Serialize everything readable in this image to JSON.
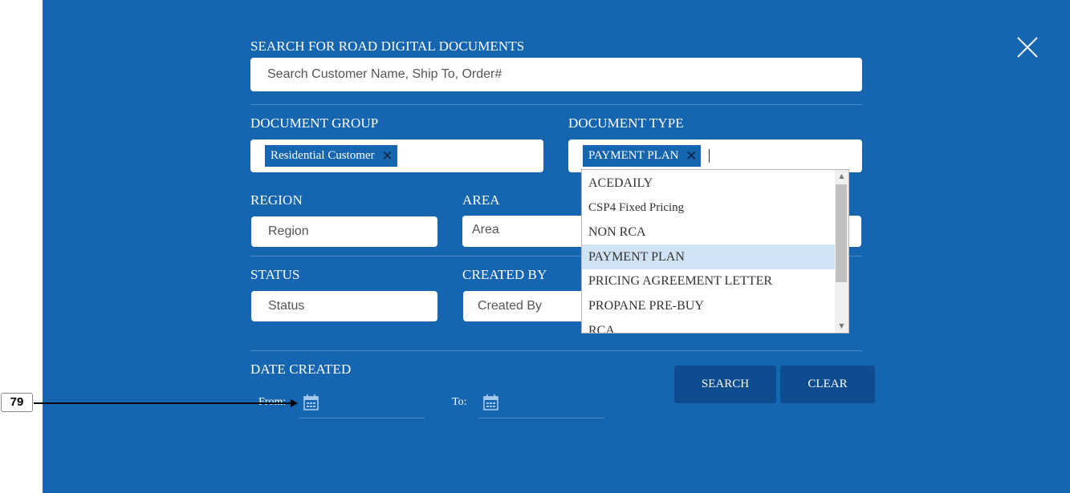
{
  "search": {
    "label": "SEARCH FOR ROAD DIGITAL DOCUMENTS",
    "placeholder": "Search Customer Name, Ship To, Order#"
  },
  "document_group": {
    "label": "DOCUMENT GROUP",
    "chip": "Residential Customer",
    "chip_remove": "✕"
  },
  "document_type": {
    "label": "DOCUMENT TYPE",
    "chip": "PAYMENT PLAN",
    "chip_remove": "✕",
    "options": [
      "ACEDAILY",
      "CSP4 Fixed Pricing",
      "NON RCA",
      "PAYMENT PLAN",
      "PRICING AGREEMENT LETTER",
      "PROPANE PRE-BUY",
      "RCA"
    ],
    "selected": "PAYMENT PLAN"
  },
  "region": {
    "label": "REGION",
    "placeholder": "Region"
  },
  "area": {
    "label": "AREA",
    "placeholder": "Area"
  },
  "status": {
    "label": "STATUS",
    "placeholder": "Status"
  },
  "created_by": {
    "label": "CREATED BY",
    "placeholder": "Created By"
  },
  "date_created": {
    "label": "DATE CREATED",
    "from_label": "From:",
    "to_label": "To:"
  },
  "buttons": {
    "search": "SEARCH",
    "clear": "CLEAR"
  },
  "close_icon": "close-icon",
  "annotation": {
    "number": "79"
  },
  "colors": {
    "panel": "#1565b0",
    "button": "#0d4d8f",
    "chip": "#1565b0",
    "selected_option": "#cfe3f5"
  }
}
